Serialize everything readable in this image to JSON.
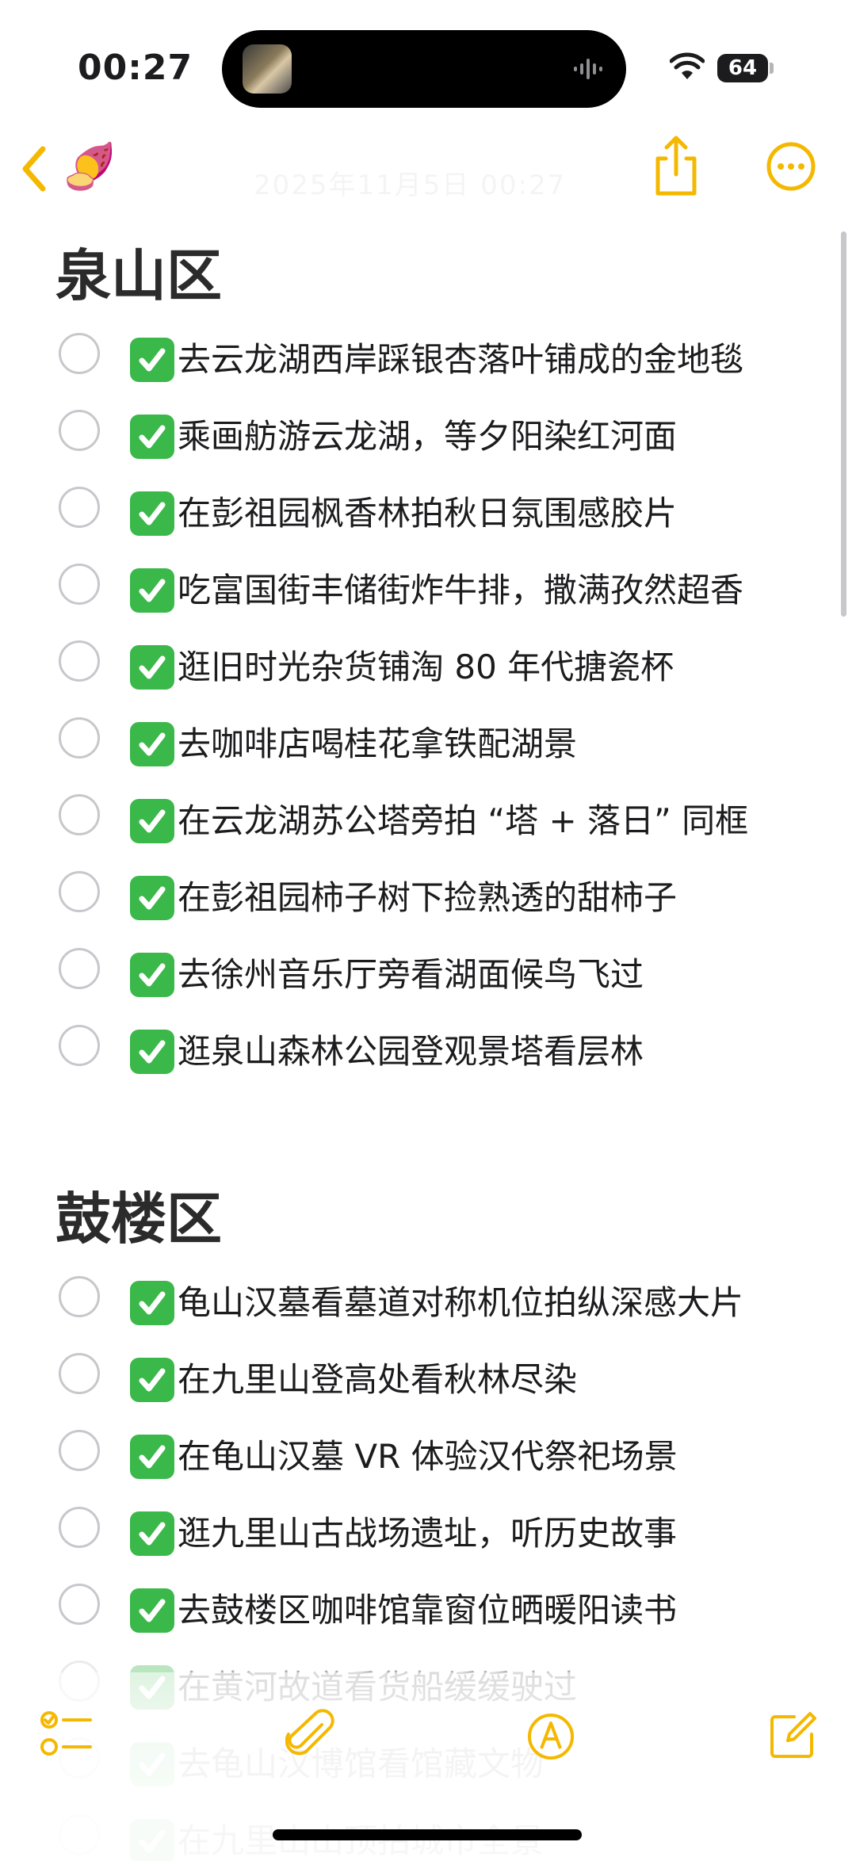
{
  "status_bar": {
    "time": "00:27",
    "battery_level": "64",
    "icons": [
      "now-playing-art",
      "audio-waveform-icon",
      "wifi-icon",
      "battery-icon"
    ]
  },
  "nav": {
    "back_icon": "chevron-left-icon",
    "note_emoji": "🍠",
    "faded_title": "2025年11月5日 00:27",
    "share_icon": "share-icon",
    "more_icon": "more-circle-icon",
    "accent_color": "#f5b800"
  },
  "sections": [
    {
      "heading": "泉山区",
      "items": [
        "去云龙湖西岸踩银杏落叶铺成的金地毯",
        "乘画舫游云龙湖，等夕阳染红河面",
        "在彭祖园枫香林拍秋日氛围感胶片",
        "吃富国街丰储街炸牛排，撒满孜然超香",
        "逛旧时光杂货铺淘 80 年代搪瓷杯",
        "去咖啡店喝桂花拿铁配湖景",
        "在云龙湖苏公塔旁拍 “塔 + 落日” 同框",
        "在彭祖园柿子树下捡熟透的甜柿子",
        "去徐州音乐厅旁看湖面候鸟飞过",
        "逛泉山森林公园登观景塔看层林"
      ]
    },
    {
      "heading": "鼓楼区",
      "items": [
        "龟山汉墓看墓道对称机位拍纵深感大片",
        "在九里山登高处看秋林尽染",
        "在龟山汉墓 VR 体验汉代祭祀场景",
        "逛九里山古战场遗址，听历史故事",
        "去鼓楼区咖啡馆靠窗位晒暖阳读书",
        "在黄河故道看货船缓缓驶过",
        "去龟山汉博馆看馆藏文物",
        "在九里山山顶拍城市全景"
      ]
    }
  ],
  "check_emoji": "✅",
  "check_color": "#3ab84a",
  "toolbar": {
    "icons": [
      "checklist-icon",
      "paperclip-icon",
      "markup-pen-icon",
      "compose-icon"
    ]
  }
}
